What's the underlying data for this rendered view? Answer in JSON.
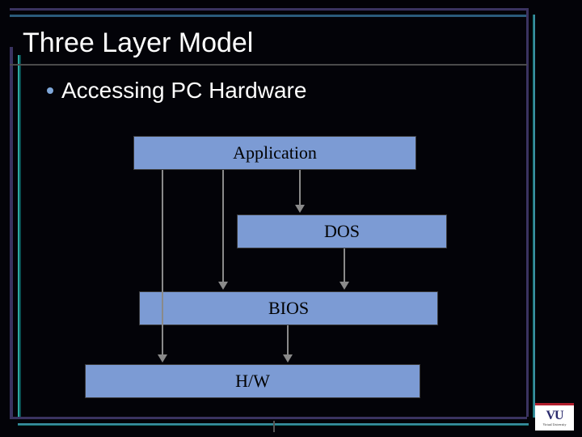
{
  "title": "Three Layer Model",
  "bullet": "Accessing PC Hardware",
  "boxes": {
    "application": "Application",
    "dos": "DOS",
    "bios": "BIOS",
    "hw": "H/W"
  },
  "logo": {
    "main": "VU",
    "sub": "Virtual University"
  },
  "colors": {
    "box_fill": "#7c9bd4",
    "accent_teal": "#14706e",
    "accent_purple": "#3a3360"
  }
}
